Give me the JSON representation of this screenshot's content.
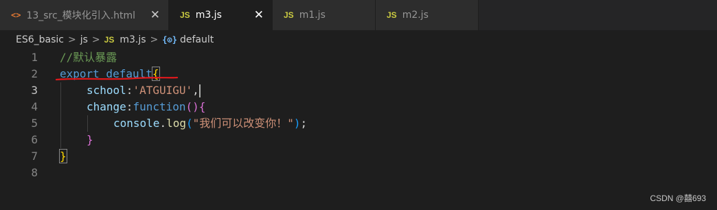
{
  "tabs": [
    {
      "icon": "<>",
      "label": "13_src_模块化引入.html",
      "close": "✕"
    },
    {
      "icon": "JS",
      "label": "m3.js",
      "close": "✕"
    },
    {
      "icon": "JS",
      "label": "m1.js"
    },
    {
      "icon": "JS",
      "label": "m2.js"
    }
  ],
  "breadcrumb": {
    "folder1": "ES6_basic",
    "folder2": "js",
    "file_icon": "JS",
    "file": "m3.js",
    "symbol_icon": "{⊙}",
    "symbol": "default",
    "separator": ">"
  },
  "editor": {
    "line_numbers": [
      "1",
      "2",
      "3",
      "4",
      "5",
      "6",
      "7",
      "8"
    ],
    "lines": {
      "l1": {
        "comment": "//默认暴露"
      },
      "l2": {
        "kw": "export default",
        "brace": "{"
      },
      "l3": {
        "prop": "school",
        "colon": ":",
        "str": "'ATGUIGU'",
        "comma": ","
      },
      "l4": {
        "prop": "change",
        "colon": ":",
        "kw": "function",
        "paren": "()",
        "brace": "{"
      },
      "l5": {
        "obj": "console",
        "dot": ".",
        "fn": "log",
        "open": "(",
        "str": "\"我们可以改变你！\"",
        "close": ")",
        "semi": ";"
      },
      "l6": {
        "brace": "}"
      },
      "l7": {
        "brace": "}"
      }
    }
  },
  "watermark": "CSDN @囍693",
  "colors": {
    "annotation_underline": "#e0191c"
  }
}
